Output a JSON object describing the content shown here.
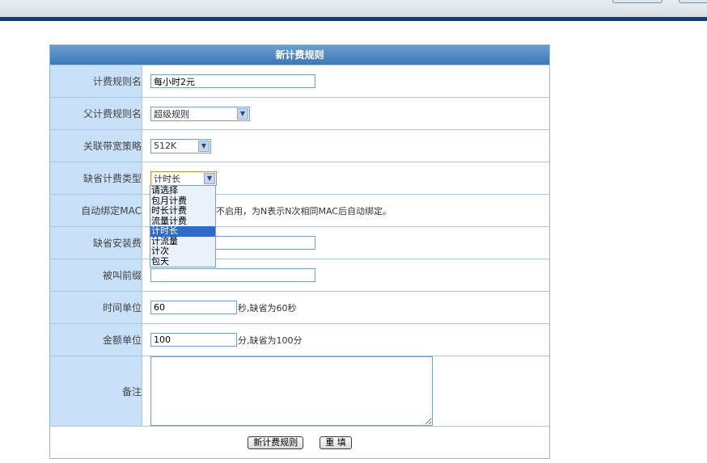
{
  "form": {
    "title": "新计费规则",
    "fields": {
      "rule_name": {
        "label": "计费规则名",
        "value": "每小时2元"
      },
      "parent_rule": {
        "label": "父计费规则名",
        "value": "超级规则"
      },
      "bandwidth": {
        "label": "关联带宽策略",
        "value": "512K"
      },
      "default_type": {
        "label": "缺省计费类型",
        "value": "计时长"
      },
      "auto_bind": {
        "label": "自动绑定MAC",
        "hint": "不启用，为N表示N次相同MAC后自动绑定。"
      },
      "install_fee": {
        "label": "缺省安装费",
        "value": ""
      },
      "called_prefix": {
        "label": "被叫前缀",
        "value": ""
      },
      "time_unit": {
        "label": "时间单位",
        "value": "60",
        "hint": "秒,缺省为60秒"
      },
      "amount_unit": {
        "label": "金额单位",
        "value": "100",
        "hint": "分,缺省为100分"
      },
      "remark": {
        "label": "备注",
        "value": ""
      }
    },
    "buttons": {
      "submit": "新计费规则",
      "reset": "重 填"
    }
  },
  "type_dropdown": {
    "options": [
      "请选择",
      "包月计费",
      "时长计费",
      "流量计费",
      "计时长",
      "计流量",
      "计次",
      "包天"
    ],
    "selected_index": 4
  },
  "colors": {
    "header_dark": "#173f74",
    "title_bar": "#3c78b7",
    "label_bg": "#c8e0f8",
    "highlight": "#316ac5"
  }
}
